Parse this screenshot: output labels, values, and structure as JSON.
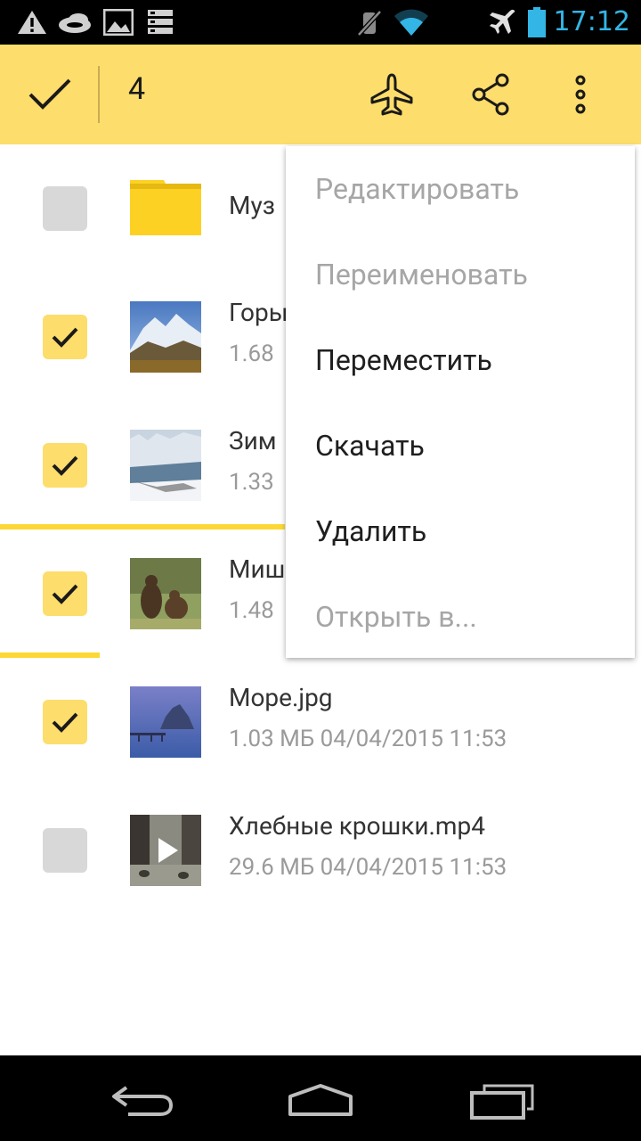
{
  "status_bar": {
    "time": "17:12",
    "icons": [
      "warning-icon",
      "cloud-icon",
      "image-icon",
      "storage-icon",
      "mute-icon",
      "wifi-icon",
      "airplane-mode-icon",
      "battery-icon"
    ],
    "accent_color": "#33b5e5"
  },
  "action_bar": {
    "selected_count": "4",
    "background_color": "#fddd6b",
    "actions": [
      "done-icon",
      "offline-icon",
      "share-icon",
      "overflow-icon"
    ]
  },
  "files": [
    {
      "name": "Муз",
      "meta": "",
      "checked": false,
      "type": "folder"
    },
    {
      "name": "Горы",
      "meta": "1.68",
      "checked": true,
      "type": "image"
    },
    {
      "name": "Зим",
      "meta": "1.33",
      "checked": true,
      "type": "image"
    },
    {
      "name": "Миш",
      "meta": "1.48",
      "checked": true,
      "type": "image"
    },
    {
      "name": "Море.jpg",
      "meta": "1.03 МБ 04/04/2015 11:53",
      "checked": true,
      "type": "image"
    },
    {
      "name": "Хлебные крошки.mp4",
      "meta": "29.6 МБ 04/04/2015 11:53",
      "checked": false,
      "type": "video"
    }
  ],
  "menu": {
    "items": [
      {
        "label": "Редактировать",
        "enabled": false
      },
      {
        "label": "Переименовать",
        "enabled": false
      },
      {
        "label": "Переместить",
        "enabled": true
      },
      {
        "label": "Скачать",
        "enabled": true
      },
      {
        "label": "Удалить",
        "enabled": true
      },
      {
        "label": "Открыть в...",
        "enabled": false
      }
    ]
  },
  "nav_bar": {
    "buttons": [
      "back-icon",
      "home-icon",
      "recent-apps-icon"
    ]
  }
}
